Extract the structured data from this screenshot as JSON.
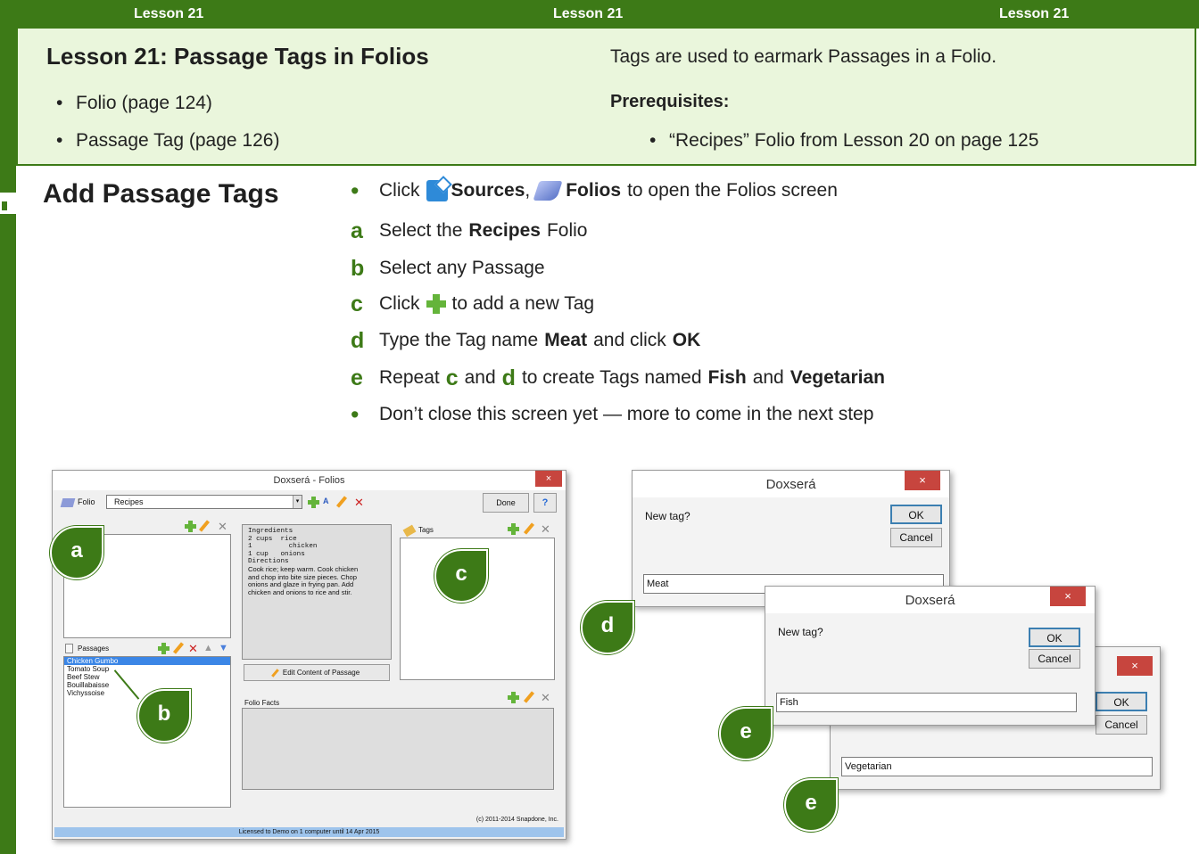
{
  "lesson_bar": {
    "labels": [
      "Lesson 21",
      "Lesson 21",
      "Lesson 21"
    ]
  },
  "header": {
    "title": "Lesson 21: Passage Tags in Folios",
    "left_bullets": [
      "Folio (page 124)",
      "Passage Tag (page 126)"
    ],
    "intro": "Tags are used to earmark Passages in a Folio.",
    "prereq_label": "Prerequisites:",
    "prereq_item": "“Recipes” Folio from Lesson 20 on page 125"
  },
  "section": {
    "title": "Add  Passage Tags"
  },
  "steps": {
    "s0": {
      "bullet": "•",
      "click": "Click",
      "sources": "Sources",
      "comma": ",",
      "folios": "Folios",
      "rest": "to open the Folios screen"
    },
    "sa": {
      "letter": "a",
      "pre": "Select the",
      "bold": "Recipes",
      "post": "Folio"
    },
    "sb": {
      "letter": "b",
      "text": "Select any Passage"
    },
    "sc": {
      "letter": "c",
      "pre": "Click",
      "post": "to add a new Tag"
    },
    "sd": {
      "letter": "d",
      "pre": "Type the Tag name",
      "bold1": "Meat",
      "mid": "and click",
      "bold2": "OK"
    },
    "se": {
      "letter": "e",
      "pre": "Repeat",
      "l1": "c",
      "and": "and",
      "l2": "d",
      "mid": "to create Tags named",
      "bold1": "Fish",
      "and2": "and",
      "bold2": "Vegetarian"
    },
    "sf": {
      "bullet": "•",
      "text": "Don’t close this screen yet — more to come in the next step"
    }
  },
  "folios_window": {
    "title": "Doxserá - Folios",
    "close": "×",
    "folio_label": "Folio",
    "folio_value": "Recipes",
    "done": "Done",
    "help": "?",
    "passages_label": "Passages",
    "passages": [
      "Chicken Gumbo",
      "Tomato Soup",
      "Beef Stew",
      "Bouillabaisse",
      "Vichyssoise"
    ],
    "content_lines": [
      "Ingredients",
      "2 cups  rice",
      "1         chicken",
      "1 cup   onions",
      "Directions",
      "Cook rice; keep warm. Cook chicken",
      "and chop into bite size pieces.  Chop",
      "onions and glaze in frying pan.  Add",
      "chicken and onions to rice and stir."
    ],
    "edit_button": "Edit Content of Passage",
    "tags_label": "Tags",
    "folio_facts_label": "Folio Facts",
    "copyright": "(c) 2011-2014 Snapdone, Inc.",
    "status": "Licensed to Demo on 1 computer until 14 Apr 2015"
  },
  "dialogs": {
    "title": "Doxserá",
    "close": "×",
    "prompt": "New tag?",
    "ok": "OK",
    "cancel": "Cancel",
    "values": [
      "Meat",
      "Fish",
      "Vegetarian"
    ]
  },
  "callouts": [
    "a",
    "b",
    "c",
    "d",
    "e",
    "e"
  ],
  "colors": {
    "accent": "#3d7a17",
    "header_bg": "#eaf6dc"
  }
}
